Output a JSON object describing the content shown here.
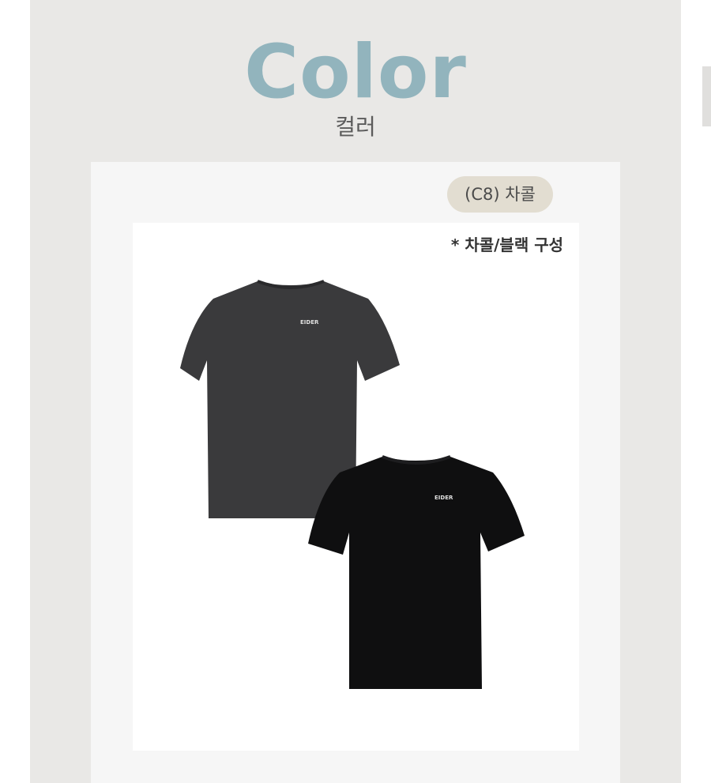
{
  "header": {
    "title": "Color",
    "subtitle": "컬러"
  },
  "option": {
    "badge_label": "(C8) 차콜",
    "composition_note": "* 차콜/블랙 구성"
  },
  "products": [
    {
      "name": "charcoal-tshirt",
      "color": "#3a3a3c",
      "logo": "EIDER"
    },
    {
      "name": "black-tshirt",
      "color": "#0f0f10",
      "logo": "EIDER"
    }
  ],
  "colors": {
    "title": "#92b4bd",
    "panel": "#e9e8e6",
    "card": "#f6f6f6",
    "badge": "#e2ddd1"
  }
}
